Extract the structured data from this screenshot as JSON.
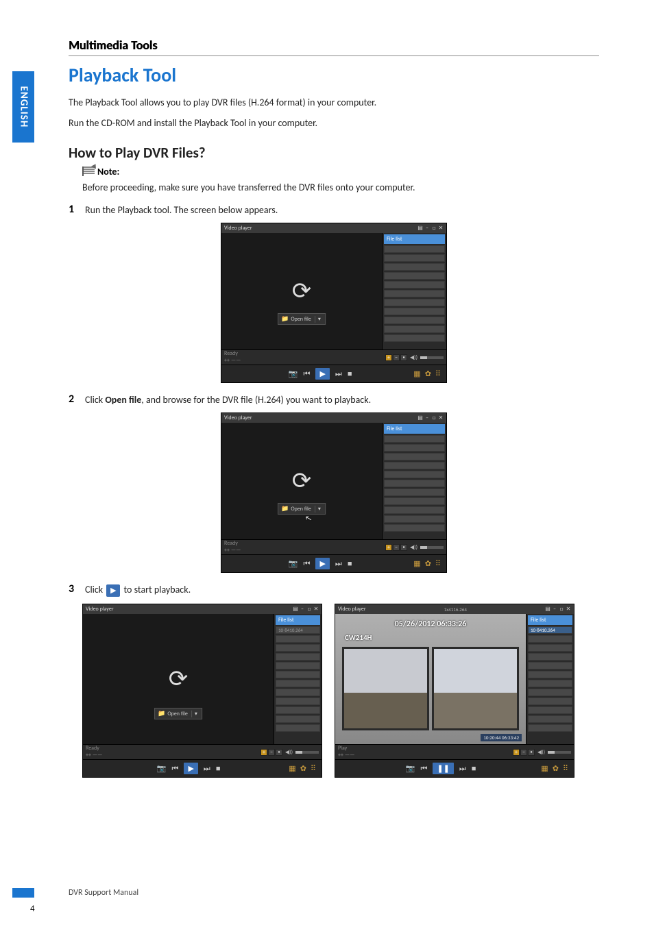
{
  "language_tab": "ENGLISH",
  "section_header": "Multimedia Tools",
  "title": "Playback Tool",
  "intro_1": "The Playback Tool allows you to play DVR files (H.264 format) in your computer.",
  "intro_2": "Run the CD-ROM and install the Playback Tool in your computer.",
  "howto_heading": "How to Play DVR Files?",
  "note_label": "Note:",
  "note_text": "Before proceeding, make sure you have transferred the DVR files onto your computer.",
  "steps": {
    "s1_num": "1",
    "s1_text": "Run the Playback tool. The screen below appears.",
    "s2_num": "2",
    "s2_text_a": "Click ",
    "s2_bold": "Open file",
    "s2_text_b": ", and browse for the DVR file (H.264) you want to playback.",
    "s3_num": "3",
    "s3_text_a": "Click ",
    "s3_text_b": " to start playback."
  },
  "player": {
    "window_title": "Video player",
    "open_file_label": "Open file",
    "file_list_header": "File list",
    "status_ready": "Ready",
    "status_time": "++  ——",
    "status_play": "Play",
    "vol_label": "▸◂ ◀)) ▬▬",
    "video_file_item": "10-8410.264",
    "playing_timestamp": "05/26/2012 06:33:26",
    "playing_model": "CW214H",
    "playing_filetime": "10:20:44 06:33:42",
    "playing_filename": "1x4116.264"
  },
  "footer_text": "DVR Support Manual",
  "page_number": "4"
}
